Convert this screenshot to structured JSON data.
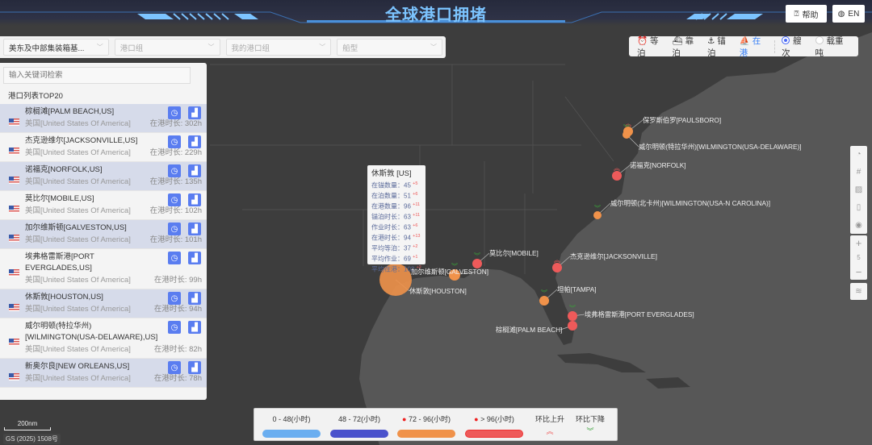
{
  "header": {
    "title": "全球港口拥堵",
    "help_label": "帮助",
    "lang_label": "EN"
  },
  "filters": [
    {
      "value": "美东及中部集装箱基...",
      "placeholder": ""
    },
    {
      "placeholder": "港口组"
    },
    {
      "placeholder": "我的港口组"
    },
    {
      "placeholder": "船型"
    }
  ],
  "modes": {
    "wait": "等泊",
    "berth": "靠泊",
    "anchor": "锚泊",
    "inport": "在港",
    "count": "艘次",
    "dwt": "载重吨"
  },
  "panel": {
    "search_placeholder": "输入关键词检索",
    "title": "港口列表TOP20",
    "duration_prefix": "在港时长: ",
    "rows": [
      {
        "name": "棕榈滩[PALM BEACH,US]",
        "country": "美国[United States Of America]",
        "duration": "302h"
      },
      {
        "name": "杰克逊维尔[JACKSONVILLE,US]",
        "country": "美国[United States Of America]",
        "duration": "229h"
      },
      {
        "name": "诺福克[NORFOLK,US]",
        "country": "美国[United States Of America]",
        "duration": "135h"
      },
      {
        "name": "莫比尔[MOBILE,US]",
        "country": "美国[United States Of America]",
        "duration": "102h"
      },
      {
        "name": "加尔维斯顿[GALVESTON,US]",
        "country": "美国[United States Of America]",
        "duration": "101h"
      },
      {
        "name": "埃弗格雷斯港[PORT EVERGLADES,US]",
        "country": "美国[United States Of America]",
        "duration": "99h"
      },
      {
        "name": "休斯敦[HOUSTON,US]",
        "country": "美国[United States Of America]",
        "duration": "94h"
      },
      {
        "name": "威尔明顿(特拉华州)[WILMINGTON(USA-DELAWARE),US]",
        "country": "美国[United States Of America]",
        "duration": "82h"
      },
      {
        "name": "新奥尔良[NEW ORLEANS,US]",
        "country": "美国[United States Of America]",
        "duration": "78h"
      }
    ]
  },
  "tooltip": {
    "title": "休斯敦 [US]",
    "rows": [
      {
        "label": "在锚数量：",
        "value": "45",
        "delta": "+5"
      },
      {
        "label": "在泊数量：",
        "value": "51",
        "delta": "+6"
      },
      {
        "label": "在港数量：",
        "value": "96",
        "delta": "+11"
      },
      {
        "label": "锚泊时长：",
        "value": "63",
        "delta": "+11"
      },
      {
        "label": "作业时长：",
        "value": "63",
        "delta": "+6"
      },
      {
        "label": "在港时长：",
        "value": "94",
        "delta": "+13"
      },
      {
        "label": "平均等泊：",
        "value": "37",
        "delta": "+2"
      },
      {
        "label": "平均作业：",
        "value": "69",
        "delta": "+1"
      },
      {
        "label": "平均在港：",
        "value": "102",
        "delta": "+2"
      }
    ]
  },
  "map_labels": {
    "paulsboro": "保罗斯伯罗[PAULSBORO]",
    "wilm_de": "威尔明顿(特拉华州)[WILMINGTON(USA-DELAWARE)]",
    "norfolk": "诺福克[NORFOLK]",
    "wilm_nc": "威尔明顿(北卡州)[WILMINGTON(USA-N CAROLINA)]",
    "jacksonville": "杰克逊维尔[JACKSONVILLE]",
    "mobile": "莫比尔[MOBILE]",
    "galveston": "加尔维斯顿[GALVESTON]",
    "houston": "休斯敦[HOUSTON]",
    "tampa": "坦帕[TAMPA]",
    "everglades": "埃弗格雷斯港[PORT EVERGLADES]",
    "palmbeach": "棕榈滩[PALM BEACH]"
  },
  "zoom_level": "5",
  "legend": {
    "r1": "0 - 48(小时)",
    "r2": "48 - 72(小时)",
    "r3": "72 - 96(小时)",
    "r4": "> 96(小时)",
    "up": "环比上升",
    "down": "环比下降",
    "colors": {
      "r1": "#6aaef0",
      "r2": "#4a52cc",
      "r3": "#f0924a",
      "r4": "#ee5a5a",
      "up": "#ee5a5a",
      "down": "#3aa03a"
    }
  },
  "scale": "200nm",
  "gs": "GS (2025) 1508号"
}
